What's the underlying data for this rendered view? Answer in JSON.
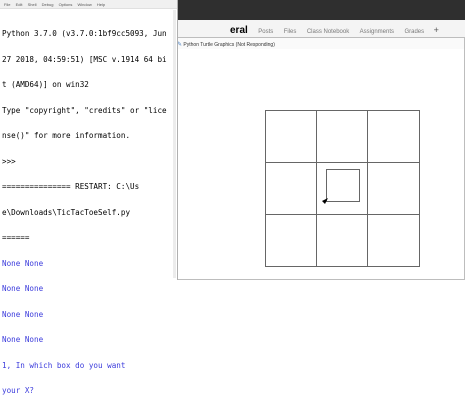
{
  "browser": {
    "tabs": [
      "eral",
      "Posts",
      "Files",
      "Class Notebook",
      "Assignments",
      "Grades"
    ],
    "plus": "+"
  },
  "turtle": {
    "title": "Python Turtle Graphics (Not Responding)",
    "grid_color": "#666666"
  },
  "idle": {
    "menu": [
      "File",
      "Edit",
      "Shell",
      "Debug",
      "Options",
      "Window",
      "Help"
    ],
    "lines": [
      {
        "text": "Python 3.7.0 (v3.7.0:1bf9cc5093, Jun",
        "style": "out"
      },
      {
        "text": "27 2018, 04:59:51) [MSC v.1914 64 bi",
        "style": "out"
      },
      {
        "text": "t (AMD64)] on win32",
        "style": "out"
      },
      {
        "text": "Type \"copyright\", \"credits\" or \"lice",
        "style": "out"
      },
      {
        "text": "nse()\" for more information.",
        "style": "out"
      },
      {
        "text": ">>>",
        "style": "out"
      },
      {
        "text": "=============== RESTART: C:\\Us",
        "style": "out"
      },
      {
        "text": "e\\Downloads\\TicTacToeSelf.py",
        "style": "out"
      },
      {
        "text": "======",
        "style": "out"
      },
      {
        "text": "None None",
        "style": "blue"
      },
      {
        "text": "None None",
        "style": "blue"
      },
      {
        "text": "None None",
        "style": "blue"
      },
      {
        "text": "None None",
        "style": "blue"
      },
      {
        "text": "1, In which box do you want",
        "style": "blue"
      },
      {
        "text": "your X?",
        "style": "blue"
      }
    ]
  }
}
